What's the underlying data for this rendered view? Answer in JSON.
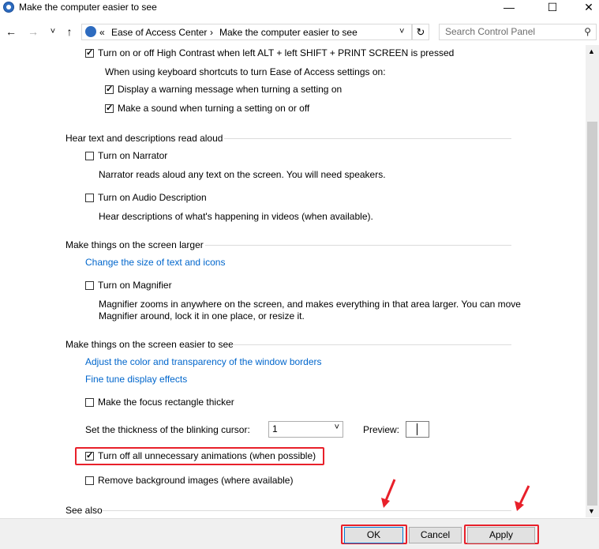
{
  "window": {
    "title": "Make the computer easier to see",
    "minimize_glyph": "—",
    "maximize_glyph": "☐",
    "close_glyph": "✕"
  },
  "nav": {
    "back_glyph": "←",
    "forward_glyph": "→",
    "recent_glyph": "˅",
    "up_glyph": "↑",
    "breadcrumb_sep": "«",
    "crumbs": [
      "Ease of Access Center",
      "Make the computer easier to see"
    ],
    "crumb_arrow": "›",
    "dropdown_glyph": "˅",
    "refresh_glyph": "↻",
    "search_placeholder": "Search Control Panel"
  },
  "options": {
    "high_contrast_shortcut": "Turn on or off High Contrast when left ALT + left SHIFT + PRINT SCREEN is pressed",
    "shortcut_intro": "When using keyboard shortcuts to turn Ease of Access settings on:",
    "display_warning": "Display a warning message when turning a setting on",
    "make_sound": "Make a sound when turning a setting on or off"
  },
  "sections": {
    "hear_text": {
      "heading": "Hear text and descriptions read aloud",
      "narrator_label": "Turn on Narrator",
      "narrator_desc": "Narrator reads aloud any text on the screen. You will need speakers.",
      "audio_desc_label": "Turn on Audio Description",
      "audio_desc_desc": "Hear descriptions of what's happening in videos (when available)."
    },
    "larger": {
      "heading": "Make things on the screen larger",
      "change_size_link": "Change the size of text and icons",
      "magnifier_label": "Turn on Magnifier",
      "magnifier_desc_1": "Magnifier zooms in anywhere on the screen, and makes everything in that area larger. You can move",
      "magnifier_desc_2": "Magnifier around, lock it in one place, or resize it."
    },
    "easier": {
      "heading": "Make things on the screen easier to see",
      "adjust_color_link": "Adjust the color and transparency of the window borders",
      "fine_tune_link": "Fine tune display effects",
      "focus_rect_label": "Make the focus rectangle thicker",
      "cursor_thickness_label": "Set the thickness of the blinking cursor:",
      "cursor_thickness_value": "1",
      "preview_label": "Preview:",
      "animations_label": "Turn off all unnecessary animations (when possible)",
      "background_images_label": "Remove background images (where available)"
    },
    "see_also": {
      "heading": "See also"
    }
  },
  "buttons": {
    "ok": "OK",
    "cancel": "Cancel",
    "apply": "Apply"
  },
  "colors": {
    "link": "#0066cc",
    "highlight": "#e8202a"
  }
}
